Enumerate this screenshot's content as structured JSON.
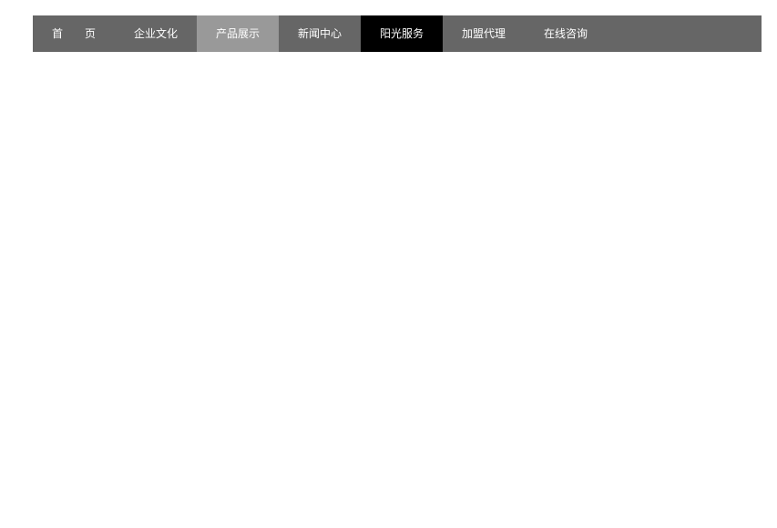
{
  "nav": {
    "items": [
      {
        "label": "首　　页",
        "state": "normal"
      },
      {
        "label": "企业文化",
        "state": "normal"
      },
      {
        "label": "产品展示",
        "state": "hover"
      },
      {
        "label": "新闻中心",
        "state": "normal"
      },
      {
        "label": "阳光服务",
        "state": "active"
      },
      {
        "label": "加盟代理",
        "state": "normal"
      },
      {
        "label": "在线咨询",
        "state": "normal"
      }
    ]
  },
  "colors": {
    "bar": "#666666",
    "hover": "#999999",
    "active": "#000000",
    "text": "#ffffff"
  }
}
